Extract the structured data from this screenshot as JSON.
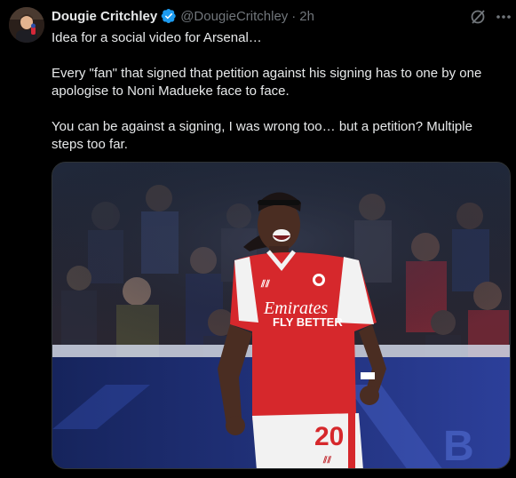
{
  "author": {
    "display_name": "Dougie Critchley",
    "handle": "@DougieCritchley",
    "separator": "·",
    "timestamp": "2h",
    "verified": true,
    "verified_color": "#1d9bf0"
  },
  "icons": {
    "grok": "grok-icon",
    "more": "more-options-icon",
    "verified": "verified-badge-icon"
  },
  "tweet": {
    "paragraphs": [
      "Idea for a social video for Arsenal…",
      "Every \"fan\" that signed that petition against his signing has to one by one apologise to Noni Madueke face to face.",
      "You can be against a signing, I was wrong too… but a petition? Multiple steps too far."
    ]
  },
  "media": {
    "shirt_sponsor_line1": "Emirates",
    "shirt_sponsor_line2": "FLY BETTER",
    "shirt_number": "20",
    "kit_color": "#d6282c"
  }
}
